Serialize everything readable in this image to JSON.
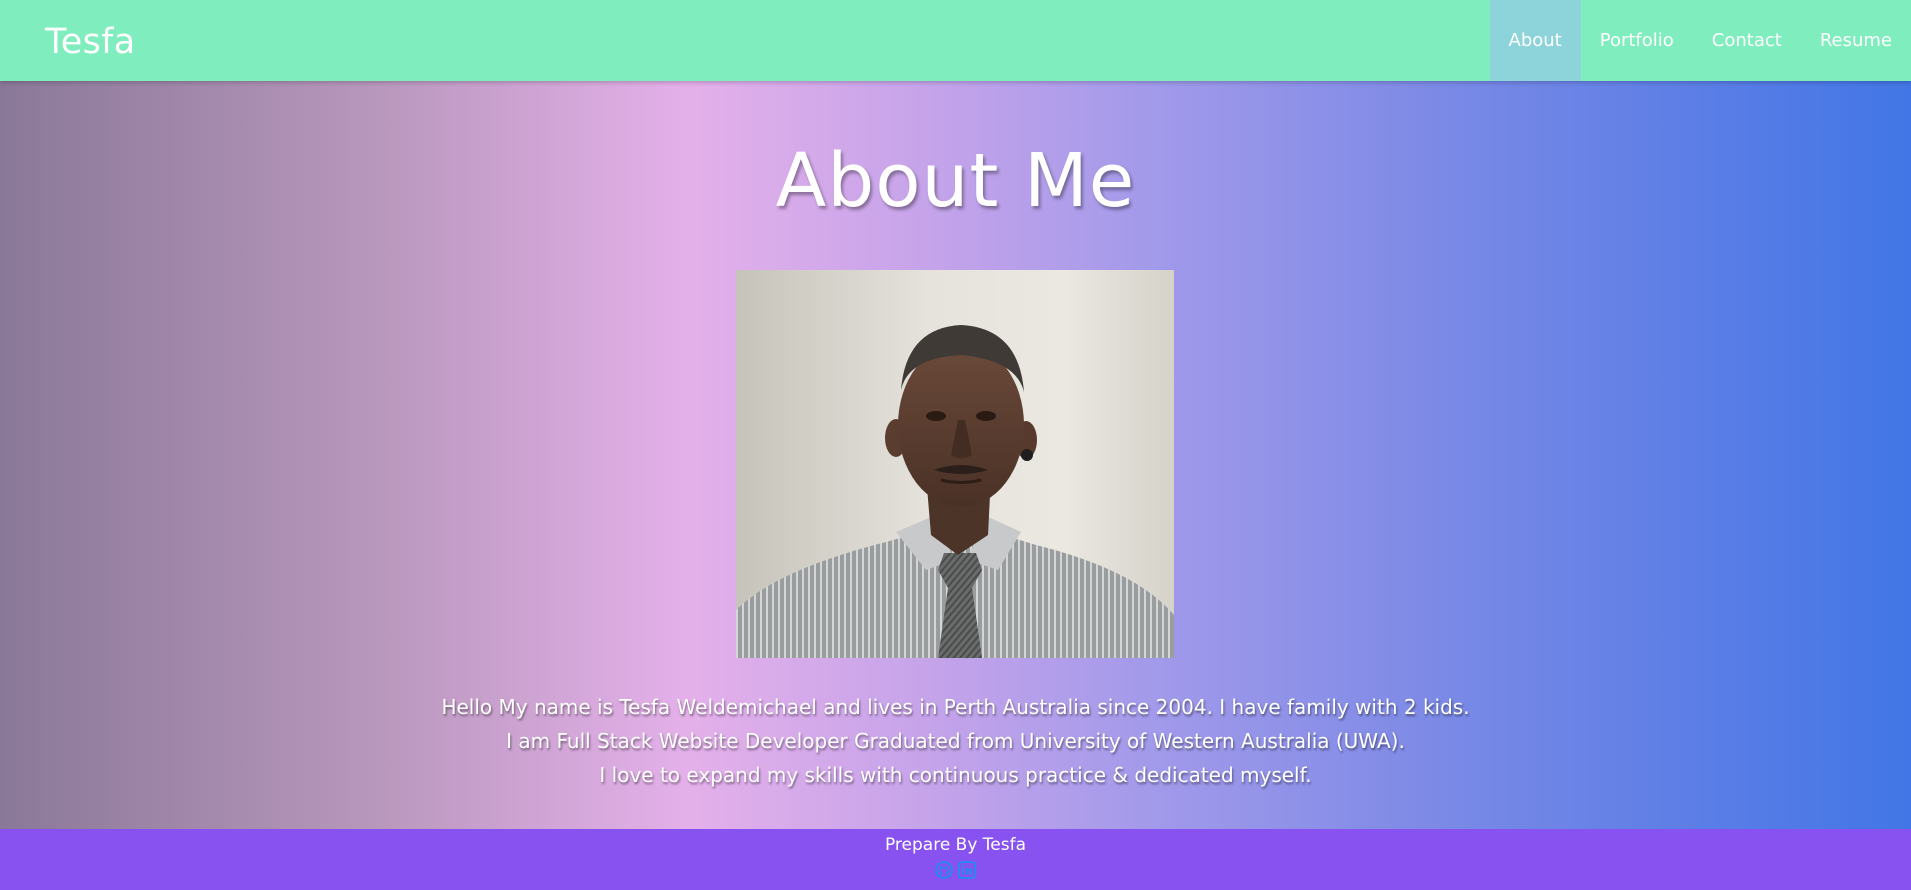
{
  "navbar": {
    "brand": "Tesfa",
    "links": [
      {
        "label": "About",
        "active": true
      },
      {
        "label": "Portfolio",
        "active": false
      },
      {
        "label": "Contact",
        "active": false
      },
      {
        "label": "Resume",
        "active": false
      }
    ]
  },
  "main": {
    "title": "About Me",
    "bio": [
      "Hello My name is Tesfa Weldemichael and lives in Perth Australia since 2004. I have family with 2 kids.",
      "I am Full Stack Website Developer Graduated from University of Western Australia (UWA).",
      "I love to expand my skills with continuous practice & dedicated myself."
    ]
  },
  "footer": {
    "text": "Prepare By Tesfa",
    "icons": [
      "github-icon",
      "linkedin-icon"
    ]
  },
  "colors": {
    "navbar": "#7fedbd",
    "nav_active": "#8dd3da",
    "footer": "#8752ef",
    "icon_blue": "#1d8ff0"
  }
}
